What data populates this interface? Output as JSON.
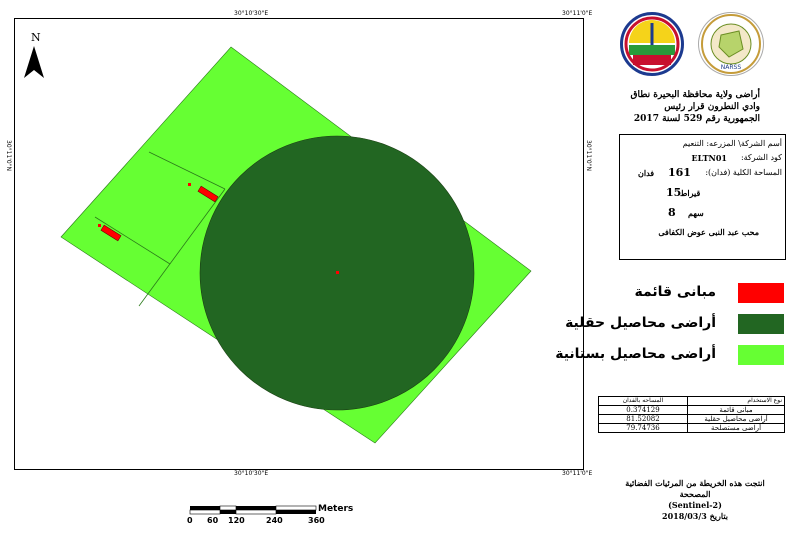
{
  "map": {
    "coordinates": {
      "top_left": "30°10'30\"E",
      "top_right": "30°11'0\"E",
      "bottom_left": "30°10'30\"E",
      "bottom_right": "30°11'0\"E",
      "left_side": "30°11'0\"N",
      "right_side": "30°11'0\"N"
    },
    "north_label": "N",
    "colors": {
      "orchard": "#66ff33",
      "field_crops": "#226622",
      "buildings": "#ff0000"
    }
  },
  "header": {
    "title_line1": "أراضى ولاية محافظة البحيرة نطاق",
    "title_line2": "وادي النطرون قرار رئيس",
    "title_line3": "الجمهورية رقم 529 لسنة 2017"
  },
  "info": {
    "company": "أسم الشركة\\ المزرعه: التنعيم",
    "code_label": "كود الشركة:",
    "code_value": "ELTN01",
    "area_label": "المساحة الكلية (فدان):",
    "feddan_value": "161",
    "feddan_unit": "فدان",
    "qirat_value": "15",
    "qirat_unit": "قيراط",
    "sahm_value": "8",
    "sahm_unit": "سهم",
    "owner": "محب عبد النبى عوض الكفافى"
  },
  "legend": [
    {
      "label": "مبانى قائمة",
      "color": "#ff0000"
    },
    {
      "label": "أراضى محاصيل حقلية",
      "color": "#226622"
    },
    {
      "label": "أراضى محاصيل بستانية",
      "color": "#66ff33"
    }
  ],
  "stats_table": {
    "headers": [
      "المساحه بالفدان",
      "نوع الاستخدام"
    ],
    "rows": [
      [
        "0.374129",
        "مبانى قائمة"
      ],
      [
        "81.52082",
        "أراضى محاصيل حقلية"
      ],
      [
        "79.74736",
        "أراضى مستصلحة"
      ]
    ]
  },
  "source": {
    "line1": "انتجت هذه الخريطة من المرئيات الفضائية المصححة",
    "line2": "(Sentinel-2)",
    "line3": "بتاريخ 2018/03/3"
  },
  "scale_bar": {
    "unit": "Meters",
    "ticks": [
      "0",
      "60",
      "120",
      "240",
      "360"
    ]
  }
}
